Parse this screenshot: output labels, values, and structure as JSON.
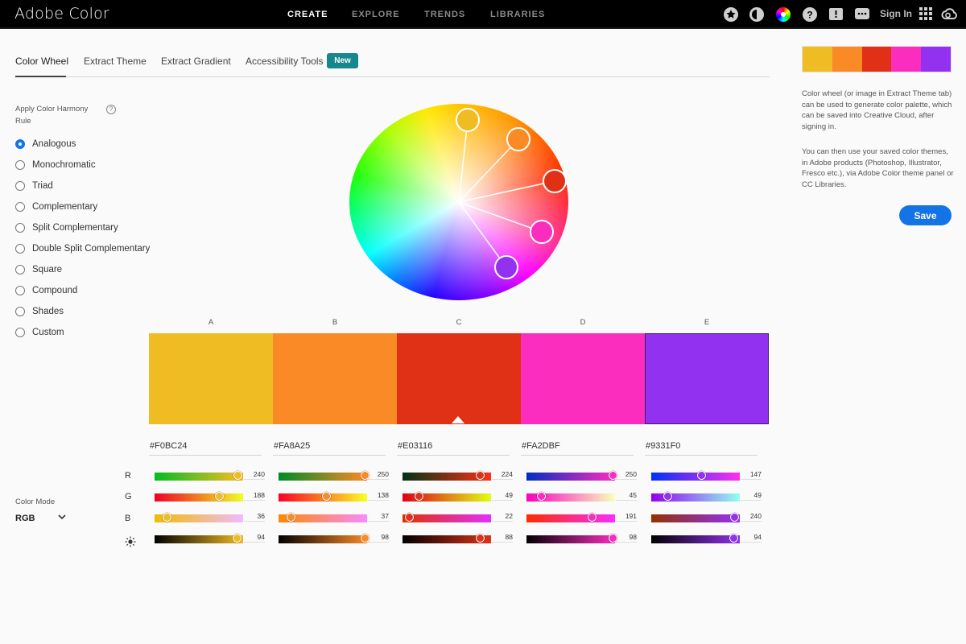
{
  "app": {
    "title": "Adobe Color"
  },
  "nav": {
    "items": [
      "CREATE",
      "EXPLORE",
      "TRENDS",
      "LIBRARIES"
    ],
    "active": "CREATE"
  },
  "header_icons": [
    "star-icon",
    "moon-icon",
    "color-wheel-icon",
    "help-icon",
    "feedback-icon",
    "chat-icon",
    "apps-grid-icon",
    "creative-cloud-icon"
  ],
  "header": {
    "sign_in": "Sign In"
  },
  "tabs": {
    "items": [
      "Color Wheel",
      "Extract Theme",
      "Extract Gradient",
      "Accessibility Tools"
    ],
    "active": "Color Wheel",
    "badge": "New"
  },
  "harmony": {
    "label": "Apply Color Harmony Rule",
    "help": "?",
    "options": [
      "Analogous",
      "Monochromatic",
      "Triad",
      "Complementary",
      "Split Complementary",
      "Double Split Complementary",
      "Square",
      "Compound",
      "Shades",
      "Custom"
    ],
    "selected": "Analogous"
  },
  "color_mode": {
    "label": "Color Mode",
    "value": "RGB"
  },
  "channels": {
    "r": "R",
    "g": "G",
    "b": "B"
  },
  "palette": [
    {
      "label": "A",
      "hex": "#F0BC24",
      "r": 240,
      "g": 188,
      "b": 36,
      "brightness": 94
    },
    {
      "label": "B",
      "hex": "#FA8A25",
      "r": 250,
      "g": 138,
      "b": 37,
      "brightness": 98
    },
    {
      "label": "C",
      "hex": "#E03116",
      "r": 224,
      "g": 49,
      "b": 22,
      "brightness": 88
    },
    {
      "label": "D",
      "hex": "#FA2DBF",
      "r": 250,
      "g": 45,
      "b": 191,
      "brightness": 98
    },
    {
      "label": "E",
      "hex": "#9331F0",
      "r": 147,
      "g": 49,
      "b": 240,
      "brightness": 94
    }
  ],
  "selected_swatch": "C",
  "sidebar": {
    "info_1": "Color wheel (or image in Extract Theme tab) can be used to generate color palette, which can be saved into Creative Cloud, after signing in.",
    "info_2": "You can then use your saved color themes, in Adobe products (Photoshop, Illustrator, Fresco etc.), via Adobe Color theme panel or CC Libraries.",
    "save_label": "Save"
  }
}
